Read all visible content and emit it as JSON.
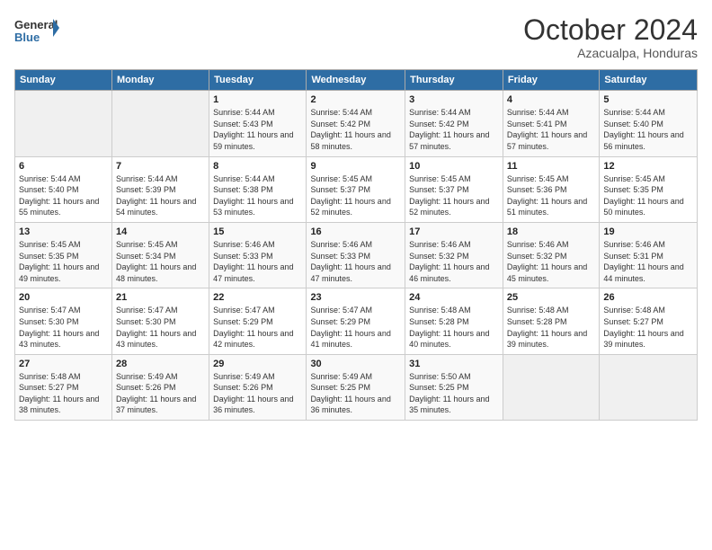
{
  "header": {
    "logo_general": "General",
    "logo_blue": "Blue",
    "month": "October 2024",
    "location": "Azacualpa, Honduras"
  },
  "weekdays": [
    "Sunday",
    "Monday",
    "Tuesday",
    "Wednesday",
    "Thursday",
    "Friday",
    "Saturday"
  ],
  "weeks": [
    [
      {
        "day": "",
        "info": ""
      },
      {
        "day": "",
        "info": ""
      },
      {
        "day": "1",
        "info": "Sunrise: 5:44 AM\nSunset: 5:43 PM\nDaylight: 11 hours and 59 minutes."
      },
      {
        "day": "2",
        "info": "Sunrise: 5:44 AM\nSunset: 5:42 PM\nDaylight: 11 hours and 58 minutes."
      },
      {
        "day": "3",
        "info": "Sunrise: 5:44 AM\nSunset: 5:42 PM\nDaylight: 11 hours and 57 minutes."
      },
      {
        "day": "4",
        "info": "Sunrise: 5:44 AM\nSunset: 5:41 PM\nDaylight: 11 hours and 57 minutes."
      },
      {
        "day": "5",
        "info": "Sunrise: 5:44 AM\nSunset: 5:40 PM\nDaylight: 11 hours and 56 minutes."
      }
    ],
    [
      {
        "day": "6",
        "info": "Sunrise: 5:44 AM\nSunset: 5:40 PM\nDaylight: 11 hours and 55 minutes."
      },
      {
        "day": "7",
        "info": "Sunrise: 5:44 AM\nSunset: 5:39 PM\nDaylight: 11 hours and 54 minutes."
      },
      {
        "day": "8",
        "info": "Sunrise: 5:44 AM\nSunset: 5:38 PM\nDaylight: 11 hours and 53 minutes."
      },
      {
        "day": "9",
        "info": "Sunrise: 5:45 AM\nSunset: 5:37 PM\nDaylight: 11 hours and 52 minutes."
      },
      {
        "day": "10",
        "info": "Sunrise: 5:45 AM\nSunset: 5:37 PM\nDaylight: 11 hours and 52 minutes."
      },
      {
        "day": "11",
        "info": "Sunrise: 5:45 AM\nSunset: 5:36 PM\nDaylight: 11 hours and 51 minutes."
      },
      {
        "day": "12",
        "info": "Sunrise: 5:45 AM\nSunset: 5:35 PM\nDaylight: 11 hours and 50 minutes."
      }
    ],
    [
      {
        "day": "13",
        "info": "Sunrise: 5:45 AM\nSunset: 5:35 PM\nDaylight: 11 hours and 49 minutes."
      },
      {
        "day": "14",
        "info": "Sunrise: 5:45 AM\nSunset: 5:34 PM\nDaylight: 11 hours and 48 minutes."
      },
      {
        "day": "15",
        "info": "Sunrise: 5:46 AM\nSunset: 5:33 PM\nDaylight: 11 hours and 47 minutes."
      },
      {
        "day": "16",
        "info": "Sunrise: 5:46 AM\nSunset: 5:33 PM\nDaylight: 11 hours and 47 minutes."
      },
      {
        "day": "17",
        "info": "Sunrise: 5:46 AM\nSunset: 5:32 PM\nDaylight: 11 hours and 46 minutes."
      },
      {
        "day": "18",
        "info": "Sunrise: 5:46 AM\nSunset: 5:32 PM\nDaylight: 11 hours and 45 minutes."
      },
      {
        "day": "19",
        "info": "Sunrise: 5:46 AM\nSunset: 5:31 PM\nDaylight: 11 hours and 44 minutes."
      }
    ],
    [
      {
        "day": "20",
        "info": "Sunrise: 5:47 AM\nSunset: 5:30 PM\nDaylight: 11 hours and 43 minutes."
      },
      {
        "day": "21",
        "info": "Sunrise: 5:47 AM\nSunset: 5:30 PM\nDaylight: 11 hours and 43 minutes."
      },
      {
        "day": "22",
        "info": "Sunrise: 5:47 AM\nSunset: 5:29 PM\nDaylight: 11 hours and 42 minutes."
      },
      {
        "day": "23",
        "info": "Sunrise: 5:47 AM\nSunset: 5:29 PM\nDaylight: 11 hours and 41 minutes."
      },
      {
        "day": "24",
        "info": "Sunrise: 5:48 AM\nSunset: 5:28 PM\nDaylight: 11 hours and 40 minutes."
      },
      {
        "day": "25",
        "info": "Sunrise: 5:48 AM\nSunset: 5:28 PM\nDaylight: 11 hours and 39 minutes."
      },
      {
        "day": "26",
        "info": "Sunrise: 5:48 AM\nSunset: 5:27 PM\nDaylight: 11 hours and 39 minutes."
      }
    ],
    [
      {
        "day": "27",
        "info": "Sunrise: 5:48 AM\nSunset: 5:27 PM\nDaylight: 11 hours and 38 minutes."
      },
      {
        "day": "28",
        "info": "Sunrise: 5:49 AM\nSunset: 5:26 PM\nDaylight: 11 hours and 37 minutes."
      },
      {
        "day": "29",
        "info": "Sunrise: 5:49 AM\nSunset: 5:26 PM\nDaylight: 11 hours and 36 minutes."
      },
      {
        "day": "30",
        "info": "Sunrise: 5:49 AM\nSunset: 5:25 PM\nDaylight: 11 hours and 36 minutes."
      },
      {
        "day": "31",
        "info": "Sunrise: 5:50 AM\nSunset: 5:25 PM\nDaylight: 11 hours and 35 minutes."
      },
      {
        "day": "",
        "info": ""
      },
      {
        "day": "",
        "info": ""
      }
    ]
  ]
}
